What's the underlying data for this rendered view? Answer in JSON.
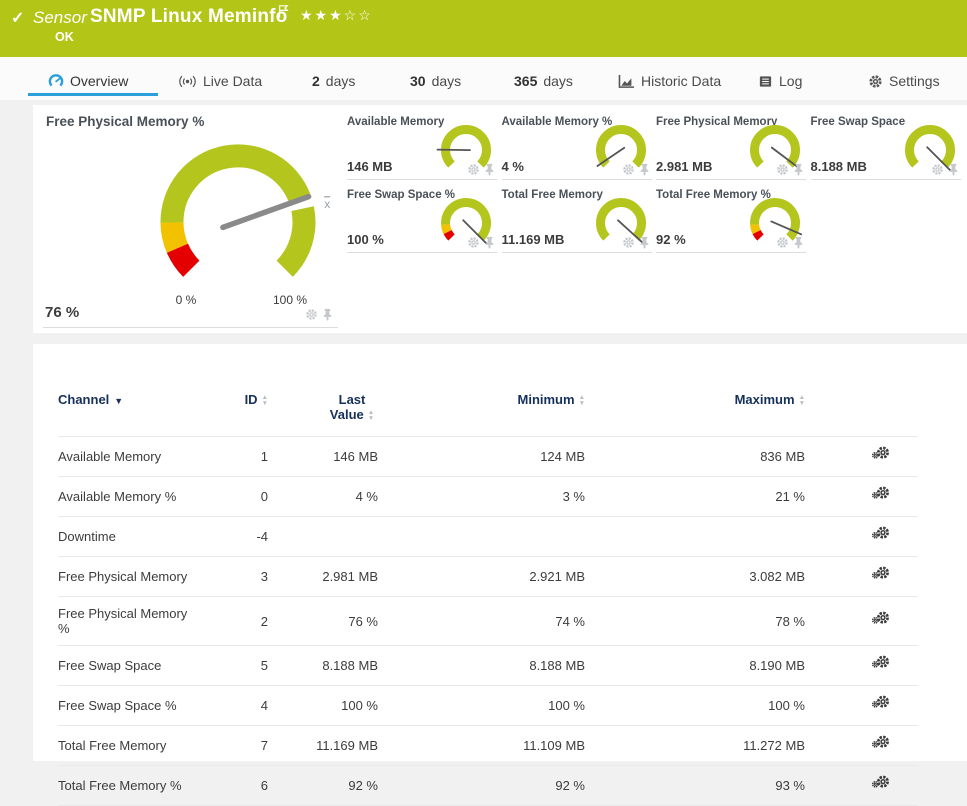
{
  "header": {
    "kind_label": "Sensor",
    "title": "SNMP Linux Meminfo",
    "status": "OK",
    "status_icon": "check",
    "stars_filled": 3,
    "stars_total": 5
  },
  "tabs": {
    "items": [
      {
        "label": "Overview",
        "icon": "gauge-icon",
        "active": true
      },
      {
        "label": "Live Data",
        "icon": "broadcast-icon"
      },
      {
        "num": "2",
        "label": "days"
      },
      {
        "num": "30",
        "label": "days"
      },
      {
        "num": "365",
        "label": "days"
      },
      {
        "label": "Historic Data",
        "icon": "chart-icon"
      },
      {
        "label": "Log",
        "icon": "log-icon"
      },
      {
        "label": "Settings",
        "icon": "gear-icon"
      }
    ]
  },
  "gauges": {
    "main": {
      "title": "Free Physical Memory %",
      "value": "76 %",
      "percent": 76,
      "min_label": "0 %",
      "max_label": "100 %",
      "avg_marker": "x",
      "has_limits": true
    },
    "mini_rows": [
      [
        {
          "title": "Available Memory",
          "value": "146 MB",
          "percent": 17,
          "has_limits": false
        },
        {
          "title": "Available Memory %",
          "value": "4 %",
          "percent": 4,
          "has_limits": false
        },
        {
          "title": "Free Physical Memory",
          "value": "2.981 MB",
          "percent": 97,
          "has_limits": false
        },
        {
          "title": "Free Swap Space",
          "value": "8.188 MB",
          "percent": 100,
          "has_limits": false
        }
      ],
      [
        {
          "title": "Free Swap Space %",
          "value": "100 %",
          "percent": 100,
          "has_limits": true
        },
        {
          "title": "Total Free Memory",
          "value": "11.169 MB",
          "percent": 99,
          "has_limits": false
        },
        {
          "title": "Total Free Memory %",
          "value": "92 %",
          "percent": 92,
          "has_limits": true
        }
      ]
    ]
  },
  "table": {
    "columns": [
      {
        "label": "Channel",
        "sorted": true
      },
      {
        "label": "ID"
      },
      {
        "label": "Last Value"
      },
      {
        "label": "Minimum"
      },
      {
        "label": "Maximum"
      }
    ],
    "rows": [
      {
        "channel": "Available Memory",
        "id": "1",
        "last": "146 MB",
        "min": "124 MB",
        "max": "836 MB"
      },
      {
        "channel": "Available Memory %",
        "id": "0",
        "last": "4 %",
        "min": "3 %",
        "max": "21 %"
      },
      {
        "channel": "Downtime",
        "id": "-4",
        "last": "",
        "min": "",
        "max": ""
      },
      {
        "channel": "Free Physical Memory",
        "id": "3",
        "last": "2.981 MB",
        "min": "2.921 MB",
        "max": "3.082 MB"
      },
      {
        "channel": "Free Physical Memory %",
        "id": "2",
        "last": "76 %",
        "min": "74 %",
        "max": "78 %"
      },
      {
        "channel": "Free Swap Space",
        "id": "5",
        "last": "8.188 MB",
        "min": "8.188 MB",
        "max": "8.190 MB"
      },
      {
        "channel": "Free Swap Space %",
        "id": "4",
        "last": "100 %",
        "min": "100 %",
        "max": "100 %"
      },
      {
        "channel": "Total Free Memory",
        "id": "7",
        "last": "11.169 MB",
        "min": "11.109 MB",
        "max": "11.272 MB"
      },
      {
        "channel": "Total Free Memory %",
        "id": "6",
        "last": "92 %",
        "min": "92 %",
        "max": "93 %"
      }
    ]
  },
  "colors": {
    "brand_green": "#b3c516",
    "gauge_green": "#b4c61e",
    "warn_yellow": "#f2c200",
    "alert_red": "#e40000",
    "accent_blue": "#2b9fd9",
    "needle_gray": "#8a8a8a",
    "header_text_navy": "#16305c"
  }
}
